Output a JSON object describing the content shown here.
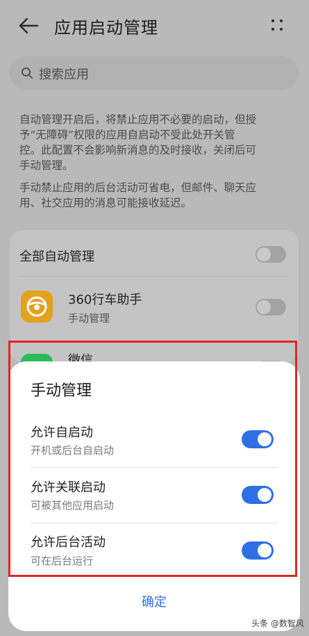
{
  "header": {
    "title": "应用启动管理"
  },
  "search": {
    "placeholder": "搜索应用"
  },
  "description": {
    "paragraph1": [
      "自动管理开启后，将禁止应用不必要的启动，但授",
      "予“无障碍”权限的应用自启动不受此处开关管",
      "控。此配置不会影响新消息的及时接收，关闭后可",
      "手动管理。"
    ],
    "paragraph2": [
      "手动禁止应用的后台活动可省电，但邮件、聊天应",
      "用、社交应用的消息可能接收延迟。"
    ]
  },
  "list": {
    "all_auto": {
      "label": "全部自动管理",
      "enabled": false
    },
    "apps": [
      {
        "name": "360行车助手",
        "status": "手动管理",
        "icon": "steering-wheel-icon",
        "color": "#e3a11f"
      },
      {
        "name": "微信",
        "icon": "wechat-icon",
        "color": "#2dbb57"
      }
    ]
  },
  "dialog": {
    "title": "手动管理",
    "options": [
      {
        "label": "允许自启动",
        "sub": "开机或后台自启动",
        "enabled": true
      },
      {
        "label": "允许关联启动",
        "sub": "可被其他应用启动",
        "enabled": true
      },
      {
        "label": "允许后台活动",
        "sub": "可在后台运行",
        "enabled": true
      }
    ],
    "confirm": "确定"
  },
  "watermark": "头条 @数智风",
  "colors": {
    "accent": "#2f6fe6",
    "highlight": "#e02626"
  }
}
